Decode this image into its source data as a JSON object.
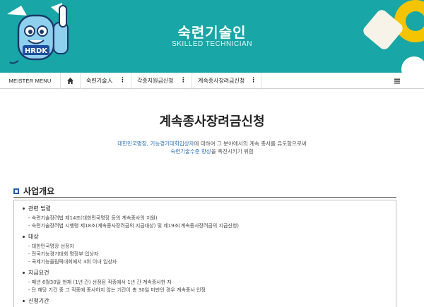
{
  "header": {
    "title": "숙련기술인",
    "subtitle": "SKILLED TECHNICIAN",
    "mascot_label": "HRDK",
    "bg_color": "#18a6a6",
    "accent_color": "#f5c400"
  },
  "nav": {
    "menu": "MEISTER MENU",
    "home_icon": "home-icon",
    "items": [
      {
        "label": "숙련기술人"
      },
      {
        "label": "각종지원금신청"
      },
      {
        "label": "계속종사장려금신청"
      }
    ],
    "menu_icon": "hamburger-icon"
  },
  "page": {
    "title": "계속종사장려금신청",
    "intro": {
      "p1": "대한민국명장, 기능경기대회입상자",
      "p2": "에 대하여 그 분야에서의 계속 종사를 유도함으로써",
      "p3": "숙련기술수준 향상",
      "p4": "을 촉진시키기 위함"
    }
  },
  "section": {
    "title": "사업개요",
    "groups": [
      {
        "heading": "관련 법령",
        "lines": [
          "- 숙련기술장려법 제14조(대한민국명장 등의 계속종사의 지원)",
          "- 숙련기술장려법 시행령 제18조(계속종사장려금의 지급대상) 및 제19조(계속종사장려금의 지급신청)"
        ]
      },
      {
        "heading": "대상",
        "lines": [
          "- 대한민국명장 선정자",
          "- 전국기능경기대회 명장부 입상자",
          "- 국제기능올림픽대회에서 3위 이내 입상자"
        ]
      },
      {
        "heading": "지급요건",
        "lines": [
          "- 매년 6월30일 현재 (1년 간) 선정된 직종에서 1년 간 계속종사한 자",
          "- 단 해당 기간 중 그 직종에 종사하지 않는 기간이 총 30일 미만인 경우 계속종사 인정"
        ]
      },
      {
        "heading": "신청기간",
        "lines": []
      }
    ]
  }
}
